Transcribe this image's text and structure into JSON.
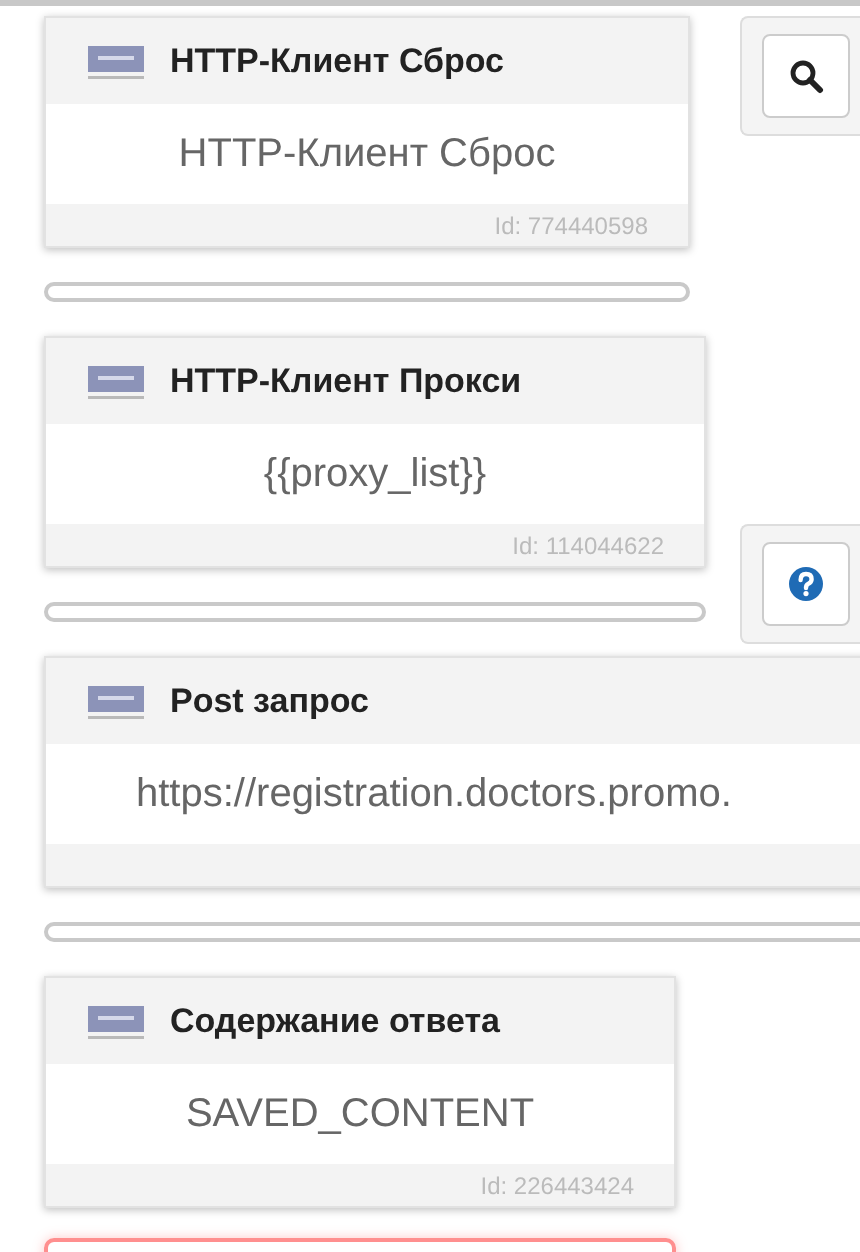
{
  "nodes": [
    {
      "title": "HTTP-Клиент Сброс",
      "value": "HTTP-Клиент Сброс",
      "id": "Id: 774440598",
      "kind": "text"
    },
    {
      "title": "HTTP-Клиент Прокси",
      "value": "{{proxy_list}}",
      "id": "Id: 114044622",
      "kind": "text"
    },
    {
      "title": "Post запрос",
      "value": "https://registration.doctors.promo.",
      "kind": "url"
    },
    {
      "title": "Содержание ответа",
      "value": "SAVED_CONTENT",
      "id": "Id: 226443424",
      "kind": "text"
    }
  ],
  "next_node": {
    "error": true
  }
}
